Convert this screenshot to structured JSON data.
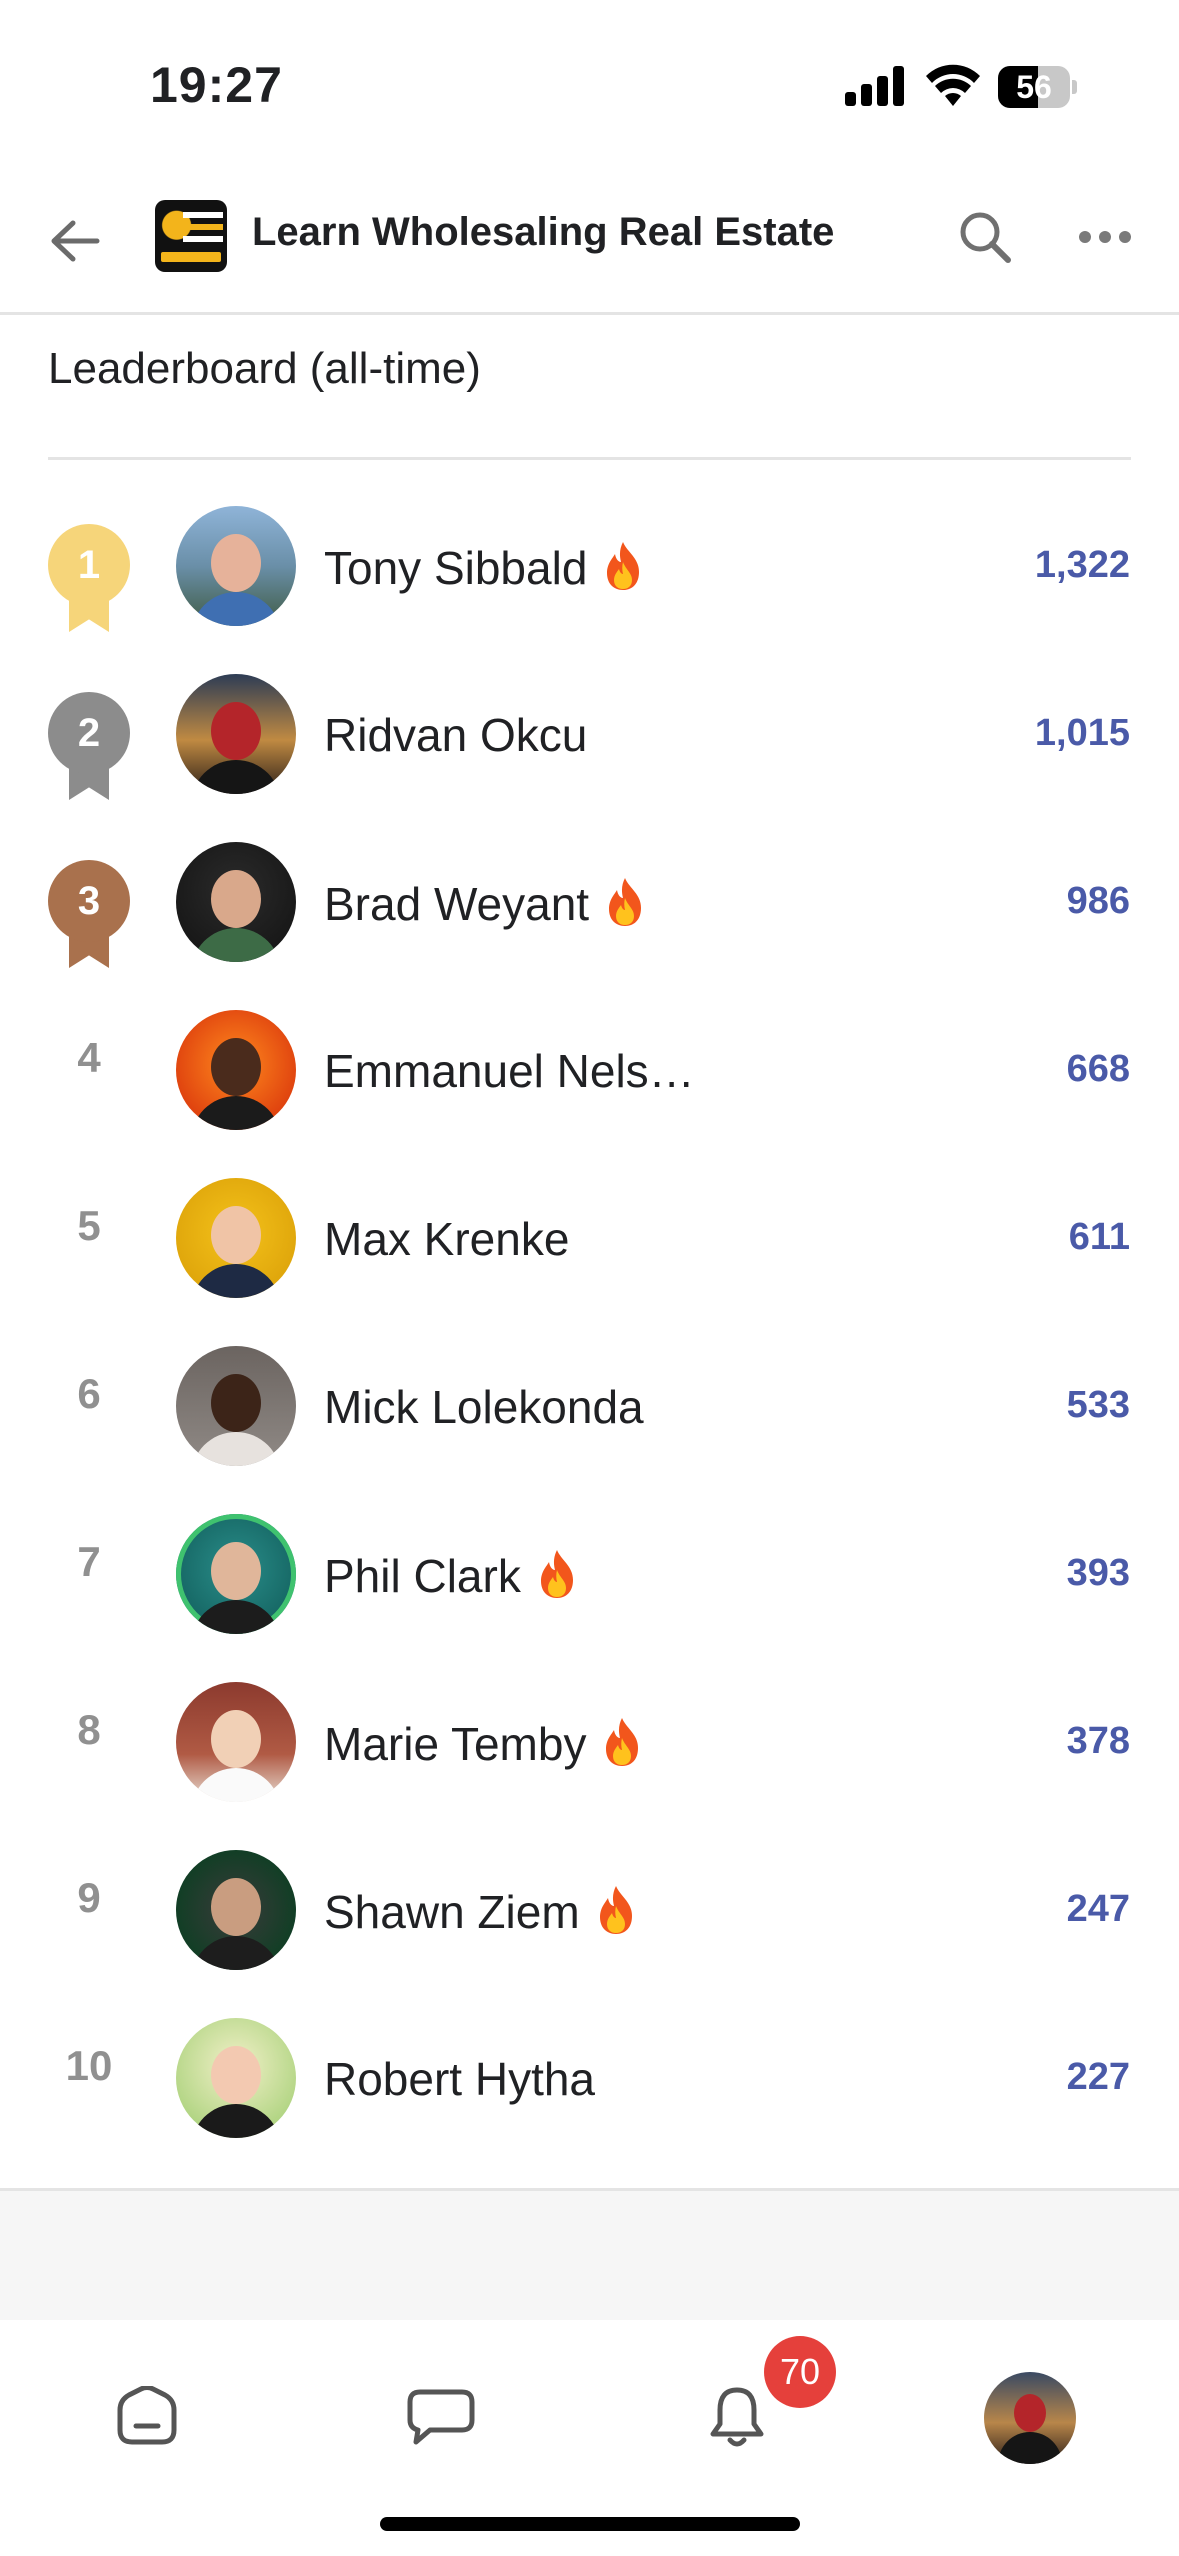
{
  "status_bar": {
    "time": "19:27",
    "battery": "56",
    "battery_level": 0.56
  },
  "header": {
    "title": "Learn Wholesaling Real Estate",
    "logo_icon": "group-logo"
  },
  "board": {
    "title": "Leaderboard (all-time)"
  },
  "colors": {
    "gold": "#f6d57a",
    "silver": "#8c8c8c",
    "bronze": "#a9714d",
    "points": "#4a5aa8",
    "badge": "#e5403b",
    "online_ring": "#3fc26f"
  },
  "leaders": [
    {
      "rank": "1",
      "name": "Tony Sibbald",
      "points": "1,322",
      "fire": true,
      "medal": "gold"
    },
    {
      "rank": "2",
      "name": "Ridvan Okcu",
      "points": "1,015",
      "fire": false,
      "medal": "silver"
    },
    {
      "rank": "3",
      "name": "Brad Weyant",
      "points": "986",
      "fire": true,
      "medal": "bronze"
    },
    {
      "rank": "4",
      "name": "Emmanuel Nels…",
      "points": "668",
      "fire": false
    },
    {
      "rank": "5",
      "name": "Max Krenke",
      "points": "611",
      "fire": false
    },
    {
      "rank": "6",
      "name": "Mick Lolekonda",
      "points": "533",
      "fire": false
    },
    {
      "rank": "7",
      "name": "Phil Clark",
      "points": "393",
      "fire": true
    },
    {
      "rank": "8",
      "name": "Marie Temby",
      "points": "378",
      "fire": true
    },
    {
      "rank": "9",
      "name": "Shawn Ziem",
      "points": "247",
      "fire": true
    },
    {
      "rank": "10",
      "name": "Robert Hytha",
      "points": "227",
      "fire": false
    }
  ],
  "tab_bar": {
    "items": [
      "home-icon",
      "chat-icon",
      "bell-icon",
      "profile-avatar"
    ],
    "notification_count": "70"
  }
}
